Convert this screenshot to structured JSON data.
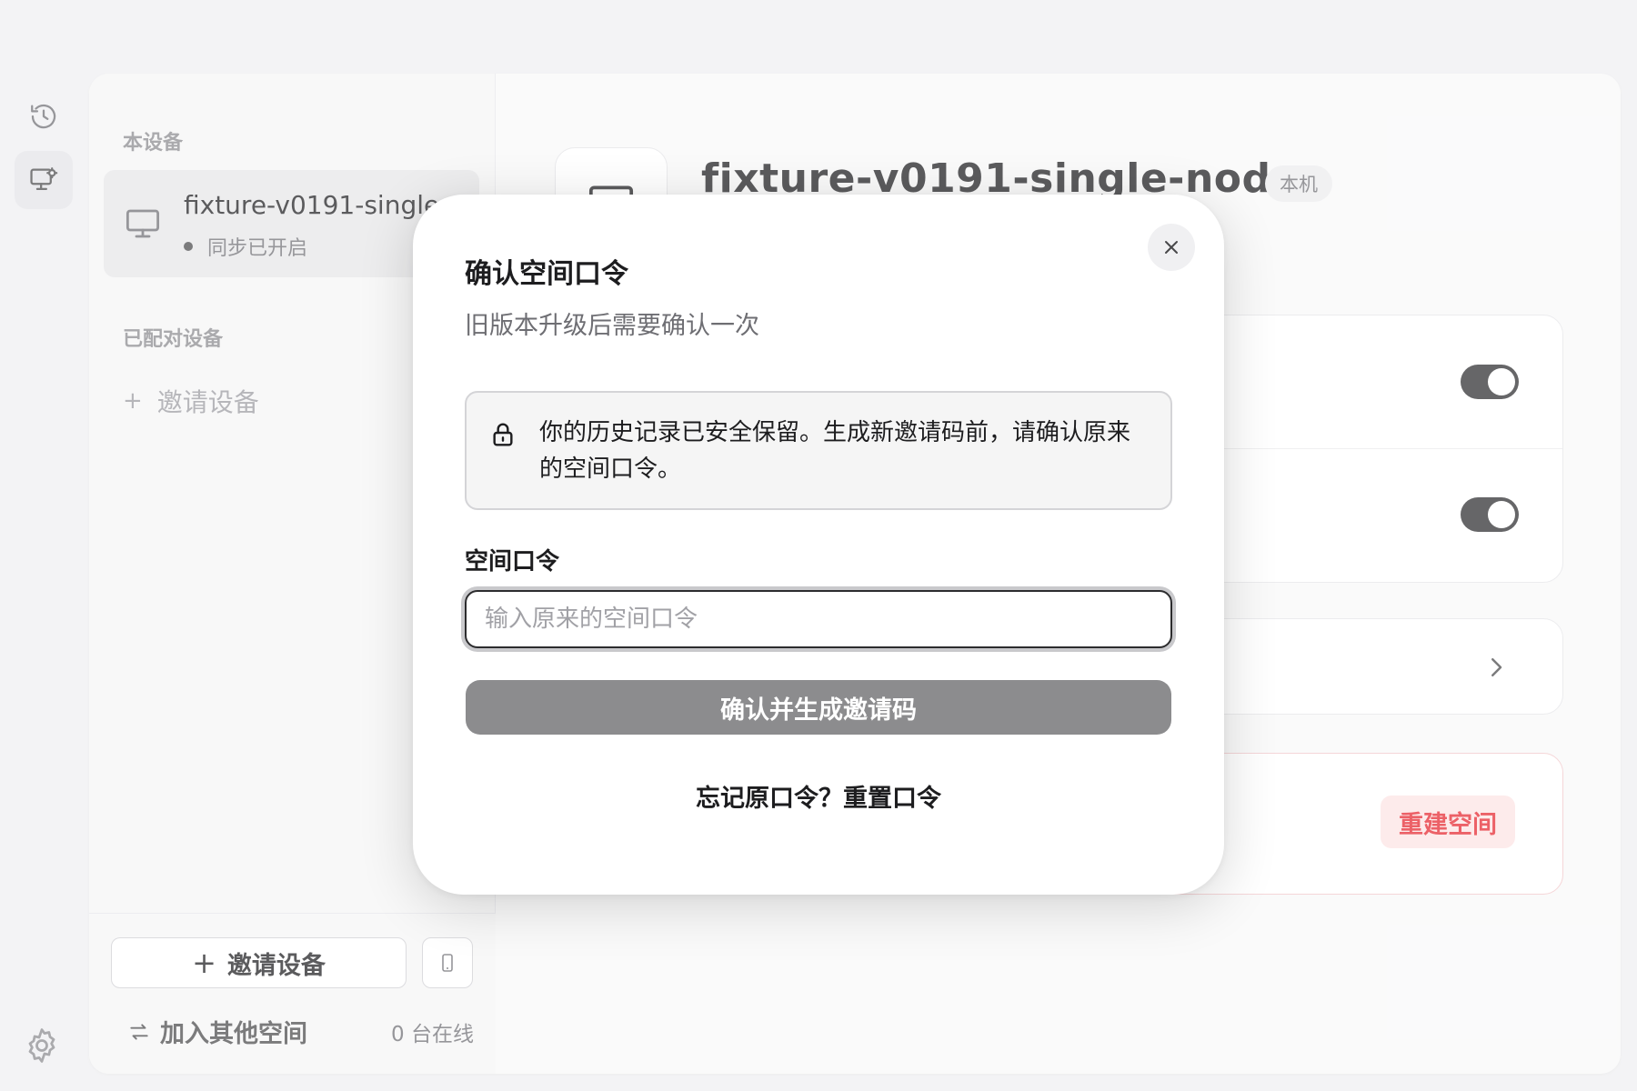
{
  "rail": {
    "items": [
      {
        "icon": "history-icon"
      },
      {
        "icon": "devices-settings-icon"
      }
    ],
    "settings_icon": "gear-icon"
  },
  "sidebar": {
    "this_device_label": "本设备",
    "device": {
      "name": "fixture-v0191-single",
      "status": "同步已开启"
    },
    "paired_label": "已配对设备",
    "invite_link": "邀请设备",
    "footer": {
      "invite_button": "邀请设备",
      "join_link": "加入其他空间",
      "online_count": "0 台在线"
    }
  },
  "content": {
    "title": "fixture-v0191-single-node",
    "local_badge": "本机",
    "rebuild_button": "重建空间"
  },
  "modal": {
    "title": "确认空间口令",
    "subtitle": "旧版本升级后需要确认一次",
    "notice": "你的历史记录已安全保留。生成新邀请码前，请确认原来的空间口令。",
    "field_label": "空间口令",
    "input_placeholder": "输入原来的空间口令",
    "input_value": "",
    "confirm_button": "确认并生成邀请码",
    "reset_link": "忘记原口令？重置口令"
  },
  "colors": {
    "danger": "#e5252d",
    "danger_bg": "#fde3e4",
    "toggle_on": "#2c2c2e",
    "button_disabled": "#8c8c8e"
  }
}
